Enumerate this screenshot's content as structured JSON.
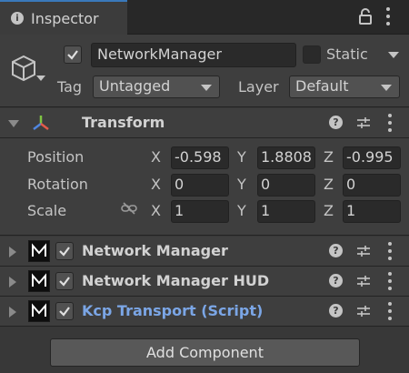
{
  "tab": {
    "title": "Inspector",
    "icon": "info-icon"
  },
  "header": {
    "object_name": "NetworkManager",
    "active": true,
    "static_label": "Static",
    "static": false,
    "tag_label": "Tag",
    "tag_value": "Untagged",
    "layer_label": "Layer",
    "layer_value": "Default"
  },
  "transform": {
    "title": "Transform",
    "position": {
      "label": "Position",
      "x": "-0.598",
      "y": "1.8808",
      "z": "-0.995"
    },
    "rotation": {
      "label": "Rotation",
      "x": "0",
      "y": "0",
      "z": "0"
    },
    "scale": {
      "label": "Scale",
      "x": "1",
      "y": "1",
      "z": "1"
    },
    "axes": {
      "x": "X",
      "y": "Y",
      "z": "Z"
    }
  },
  "components": [
    {
      "title": "Network Manager",
      "enabled": true,
      "is_script": false
    },
    {
      "title": "Network Manager HUD",
      "enabled": true,
      "is_script": false
    },
    {
      "title": "Kcp Transport (Script)",
      "enabled": true,
      "is_script": true
    }
  ],
  "footer": {
    "add_component": "Add Component"
  },
  "colors": {
    "script_title": "#7ba6e6",
    "tab_accent": "#3a79bb",
    "background": "#383838"
  }
}
